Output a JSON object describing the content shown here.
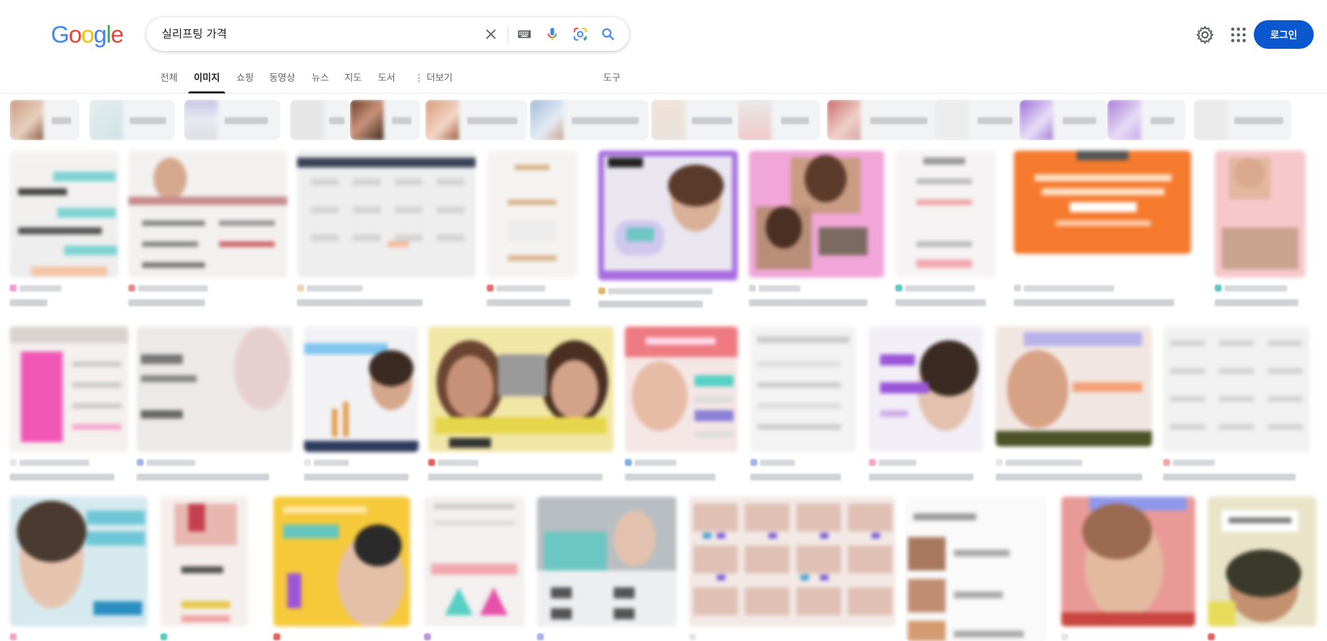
{
  "logo": {
    "letters": [
      "G",
      "o",
      "o",
      "g",
      "l",
      "e"
    ],
    "colors": [
      "#4285f4",
      "#ea4335",
      "#fbbc05",
      "#4285f4",
      "#34a853",
      "#ea4335"
    ]
  },
  "search": {
    "query": "실리프팅 가격",
    "clear_icon": "close-icon",
    "keyboard_icon": "keyboard-icon",
    "voice_icon": "microphone-icon",
    "lens_icon": "camera-lens-icon",
    "search_icon": "search-icon"
  },
  "header": {
    "settings_icon": "gear-icon",
    "apps_icon": "apps-grid-icon",
    "login_label": "로그인",
    "accent": "#0b57d0"
  },
  "tabs": [
    {
      "label": "전체",
      "active": false
    },
    {
      "label": "이미지",
      "active": true
    },
    {
      "label": "쇼핑",
      "active": false
    },
    {
      "label": "동영상",
      "active": false
    },
    {
      "label": "뉴스",
      "active": false
    },
    {
      "label": "지도",
      "active": false
    },
    {
      "label": "도서",
      "active": false
    },
    {
      "label": "⋮ 더보기",
      "active": false
    }
  ],
  "tools_label": "도구"
}
